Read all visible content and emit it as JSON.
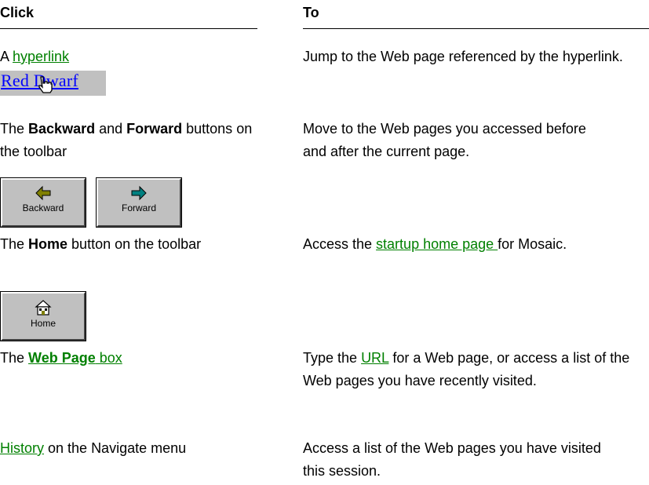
{
  "headers": {
    "click": "Click",
    "to": "To"
  },
  "rows": [
    {
      "click": {
        "prefix": "A ",
        "link": "hyperlink"
      },
      "sample_text": "Red Dwarf",
      "to": "Jump to the Web page referenced by the hyperlink."
    },
    {
      "click": {
        "part1": "The ",
        "bold1": "Backward",
        "part2": " and ",
        "bold2": "Forward",
        "part3": " buttons on the toolbar"
      },
      "buttons": {
        "backward": "Backward",
        "forward": "Forward"
      },
      "to": "Move to the Web pages you accessed before and after the current page."
    },
    {
      "click": {
        "part1": "The ",
        "bold1": "Home",
        "part2": " button on the toolbar"
      },
      "buttons": {
        "home": "Home"
      },
      "to": {
        "prefix": "Access the ",
        "link": "startup home page ",
        "suffix": " for Mosaic."
      }
    },
    {
      "click": {
        "part1": "The ",
        "link_bold": "Web Page",
        "link_rest": " box"
      },
      "to": {
        "prefix": "Type the ",
        "link": "URL",
        "suffix": " for a Web page, or access a list of the Web pages you have recently visited."
      }
    },
    {
      "click": {
        "link": "History",
        "suffix": " on the Navigate menu"
      },
      "to": "Access a list of the Web pages you have visited this session."
    }
  ],
  "colors": {
    "link": "#008000",
    "button_face": "#c0c0c0",
    "sample_link": "#0000ff"
  }
}
